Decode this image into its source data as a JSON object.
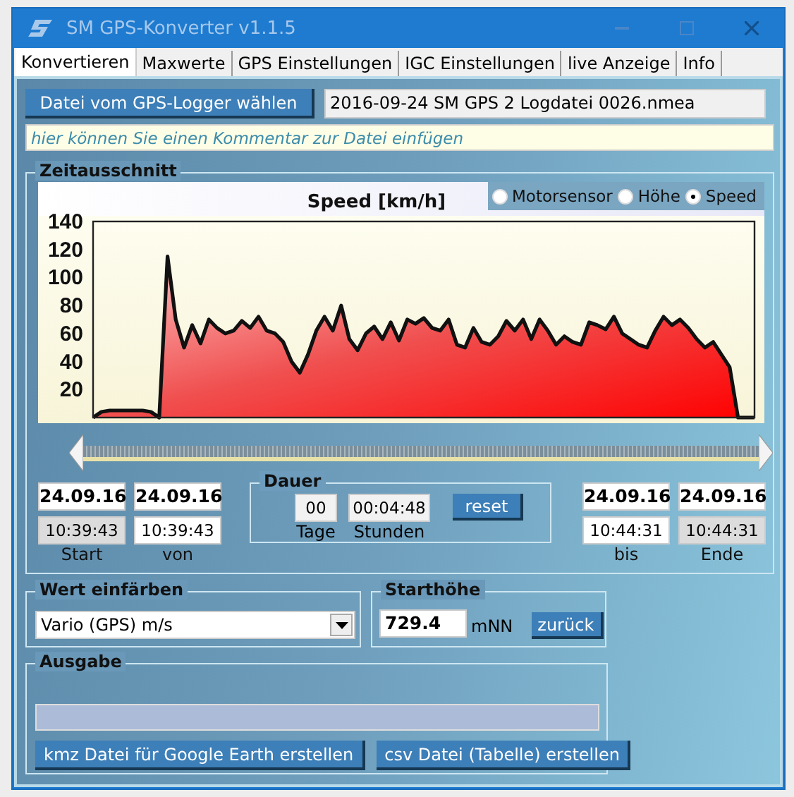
{
  "window": {
    "title": "SM GPS-Konverter v1.1.5"
  },
  "tabs": [
    {
      "label": "Konvertieren",
      "selected": true
    },
    {
      "label": "Maxwerte",
      "selected": false
    },
    {
      "label": "GPS Einstellungen",
      "selected": false
    },
    {
      "label": "IGC Einstellungen",
      "selected": false
    },
    {
      "label": "live Anzeige",
      "selected": false
    },
    {
      "label": "Info",
      "selected": false
    }
  ],
  "file": {
    "button": "Datei vom GPS-Logger wählen",
    "value": "2016-09-24 SM GPS 2 Logdatei 0026.nmea"
  },
  "comment": {
    "placeholder": "hier können Sie einen Kommentar zur Datei einfügen"
  },
  "zeitausschnitt": {
    "title": "Zeitausschnitt",
    "chart_data": {
      "type": "area",
      "title": "Speed [km/h]",
      "ylim": [
        0,
        140
      ],
      "yticks": [
        20,
        40,
        60,
        80,
        100,
        120,
        140
      ],
      "categories": [
        null,
        null,
        null,
        null,
        null,
        null,
        null,
        null,
        null,
        null,
        null,
        null,
        null,
        null,
        null,
        null,
        null,
        null,
        null,
        null,
        null,
        null,
        null,
        null,
        null,
        null,
        null,
        null,
        null,
        null,
        null,
        null,
        null,
        null,
        null,
        null,
        null,
        null,
        null,
        null,
        null,
        null,
        null,
        null,
        null,
        null,
        null,
        null,
        null,
        null,
        null,
        null,
        null,
        null,
        null,
        null,
        null,
        null,
        null,
        null,
        null,
        null,
        null,
        null,
        null,
        null,
        null,
        null,
        null,
        null,
        null,
        null,
        null,
        null,
        null,
        null,
        null,
        null,
        null,
        null,
        null
      ],
      "series": [
        {
          "color": "#111111",
          "values": [
            0,
            4,
            5,
            5,
            5,
            5,
            5,
            4,
            0,
            115,
            70,
            50,
            66,
            53,
            70,
            64,
            60,
            62,
            69,
            64,
            72,
            62,
            60,
            54,
            40,
            32,
            45,
            62,
            72,
            62,
            80,
            56,
            48,
            60,
            65,
            56,
            68,
            55,
            70,
            67,
            71,
            64,
            62,
            70,
            52,
            50,
            64,
            54,
            52,
            58,
            69,
            62,
            70,
            56,
            70,
            62,
            52,
            58,
            54,
            52,
            68,
            66,
            63,
            72,
            60,
            56,
            52,
            50,
            62,
            72,
            66,
            70,
            64,
            56,
            50,
            54,
            45,
            36,
            0,
            0,
            0
          ]
        }
      ]
    },
    "sources": [
      {
        "label": "Motorsensor",
        "selected": false
      },
      {
        "label": "Höhe",
        "selected": false
      },
      {
        "label": "Speed",
        "selected": true
      }
    ],
    "range_start": [
      {
        "date": "24.09.16",
        "time": "10:39:43",
        "label": "Start",
        "editable": false
      },
      {
        "date": "24.09.16",
        "time": "10:39:43",
        "label": "von",
        "editable": true
      }
    ],
    "dauer": {
      "title": "Dauer",
      "days": "00",
      "days_label": "Tage",
      "hours": "00:04:48",
      "hours_label": "Stunden",
      "reset": "reset"
    },
    "range_end": [
      {
        "date": "24.09.16",
        "time": "10:44:31",
        "label": "bis",
        "editable": true
      },
      {
        "date": "24.09.16",
        "time": "10:44:31",
        "label": "Ende",
        "editable": false
      }
    ]
  },
  "wert_einfaerben": {
    "title": "Wert einfärben",
    "value": "Vario (GPS) m/s"
  },
  "starthoehe": {
    "title": "Starthöhe",
    "value": "729.4",
    "unit": "mNN",
    "button": "zurück"
  },
  "ausgabe": {
    "title": "Ausgabe",
    "progress": {
      "level": 0
    },
    "buttons": [
      "kmz Datei für Google Earth erstellen",
      "csv Datei (Tabelle) erstellen"
    ]
  }
}
